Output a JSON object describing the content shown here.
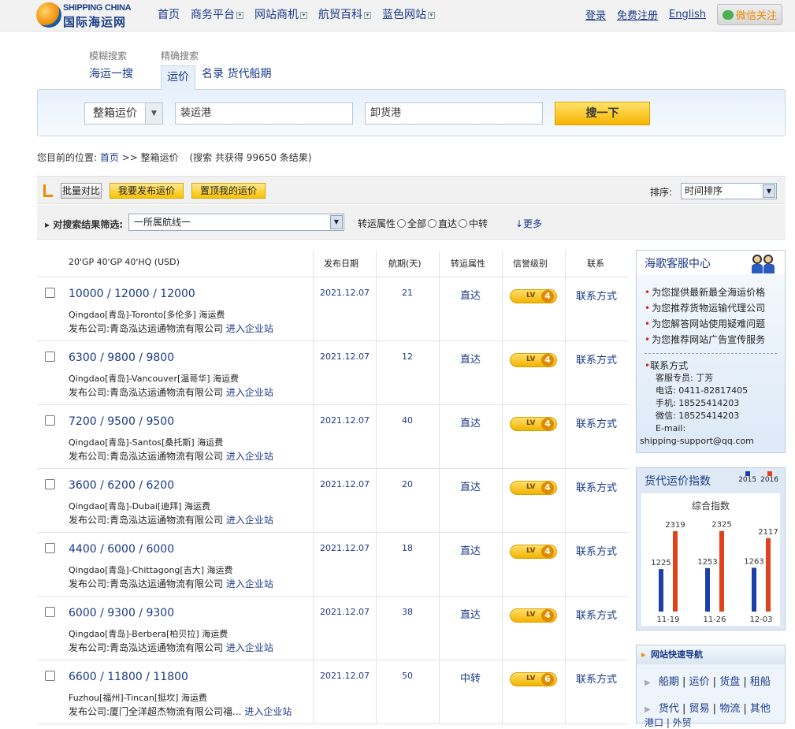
{
  "brand": {
    "logo_en": "SHIPPING CHINA",
    "logo_cn": "国际海运网"
  },
  "nav": [
    {
      "label": "首页",
      "dropdown": false
    },
    {
      "label": "商务平台",
      "dropdown": true
    },
    {
      "label": "网站商机",
      "dropdown": true
    },
    {
      "label": "航贸百科",
      "dropdown": true
    },
    {
      "label": "蓝色网站",
      "dropdown": true
    }
  ],
  "top_links": {
    "login": "登录",
    "register": "免费注册",
    "english": "English",
    "wechat": "微信关注"
  },
  "search": {
    "tab_labels": {
      "fuzzy": "模糊搜索",
      "precise": "精确搜索"
    },
    "tabs": {
      "ocean": "海运一搜",
      "rate": "运价",
      "directory": "名录",
      "schedule": "货代船期"
    },
    "type_select": "整箱运价",
    "pol_placeholder": "装运港",
    "pod_placeholder": "卸货港",
    "button": "搜一下"
  },
  "breadcrumb": {
    "prefix": "您目前的位置:",
    "home": "首页",
    "sep": ">>",
    "current": "整箱运价",
    "result": "(搜索 共获得 99650 条结果)"
  },
  "toolbar": {
    "compare": "批量对比",
    "publish": "我要发布运价",
    "top": "置顶我的运价",
    "sort_label": "排序:",
    "sort_value": "时间排序"
  },
  "filter": {
    "label": "对搜索结果筛选:",
    "route_select": "一所属航线一",
    "transit_label": "转运属性",
    "options": [
      "全部",
      "直达",
      "中转"
    ],
    "more": "↓更多"
  },
  "table": {
    "headers": {
      "containers": "20'GP    40'GP    40'HQ    (USD)",
      "date": "发布日期",
      "transit_days": "航期(天)",
      "transit": "转运属性",
      "credit": "信誉级别",
      "contact": "联系"
    },
    "company_prefix": "发布公司:",
    "site_link": "进入企业站",
    "contact_link": "联系方式",
    "level_badge": "LV",
    "rows": [
      {
        "price": "10000  /  12000  /  12000",
        "route": "Qingdao[青岛]-Toronto[多伦多] 海运费",
        "company": "青岛泓达运通物流有限公司",
        "date": "2021.12.07",
        "days": "21",
        "transit": "直达",
        "level": "4"
      },
      {
        "price": "6300  /  9800  /  9800",
        "route": "Qingdao[青岛]-Vancouver[温哥华] 海运费",
        "company": "青岛泓达运通物流有限公司",
        "date": "2021.12.07",
        "days": "12",
        "transit": "直达",
        "level": "4"
      },
      {
        "price": "7200  /  9500  /  9500",
        "route": "Qingdao[青岛]-Santos[桑托斯] 海运费",
        "company": "青岛泓达运通物流有限公司",
        "date": "2021.12.07",
        "days": "40",
        "transit": "直达",
        "level": "4"
      },
      {
        "price": "3600  /  6200  /  6200",
        "route": "Qingdao[青岛]-Dubai[迪拜] 海运费",
        "company": "青岛泓达运通物流有限公司",
        "date": "2021.12.07",
        "days": "20",
        "transit": "直达",
        "level": "4"
      },
      {
        "price": "4400  /  6000  /  6000",
        "route": "Qingdao[青岛]-Chittagong[吉大] 海运费",
        "company": "青岛泓达运通物流有限公司",
        "date": "2021.12.07",
        "days": "18",
        "transit": "直达",
        "level": "4"
      },
      {
        "price": "6000  /  9300  /  9300",
        "route": "Qingdao[青岛]-Berbera[柏贝拉] 海运费",
        "company": "青岛泓达运通物流有限公司",
        "date": "2021.12.07",
        "days": "38",
        "transit": "直达",
        "level": "4"
      },
      {
        "price": "6600  /  11800  /  11800",
        "route": "Fuzhou[福州]-Tincan[挺坎] 海运费",
        "company": "厦门全洋超杰物流有限公司福...",
        "date": "2021.12.07",
        "days": "50",
        "transit": "中转",
        "level": "6"
      }
    ]
  },
  "service": {
    "title": "海歌客服中心",
    "items": [
      "为您提供最新最全海运价格",
      "为您推荐货物运输代理公司",
      "为您解答网站使用疑难问题",
      "为您推荐网站广告宣传服务"
    ],
    "contact_title": "联系方式",
    "contact_lines": [
      "客服专员: 丁芳",
      "电话: 0411-82817405",
      "手机: 18525414203",
      "微信: 18525414203",
      "E-mail:",
      "shipping-support@qq.com"
    ]
  },
  "index_panel": {
    "title": "货代运价指数",
    "subtitle": "综合指数"
  },
  "chart_data": {
    "type": "bar",
    "title": "综合指数",
    "categories": [
      "11-19",
      "11-26",
      "12-03"
    ],
    "series": [
      {
        "name": "2015",
        "color": "#1c3fa8",
        "values": [
          1225,
          1253,
          1263
        ]
      },
      {
        "name": "2016",
        "color": "#e0421c",
        "values": [
          2319,
          2325,
          2117
        ]
      }
    ],
    "legend_position": "top-right",
    "grid": false
  },
  "quick_nav": {
    "title": "网站快速导航",
    "row1": [
      "船期",
      "运价",
      "货盘",
      "租船"
    ],
    "row2": [
      "货代",
      "贸易",
      "物流",
      "其他"
    ],
    "row3_partial": "港口 | 外贸"
  }
}
